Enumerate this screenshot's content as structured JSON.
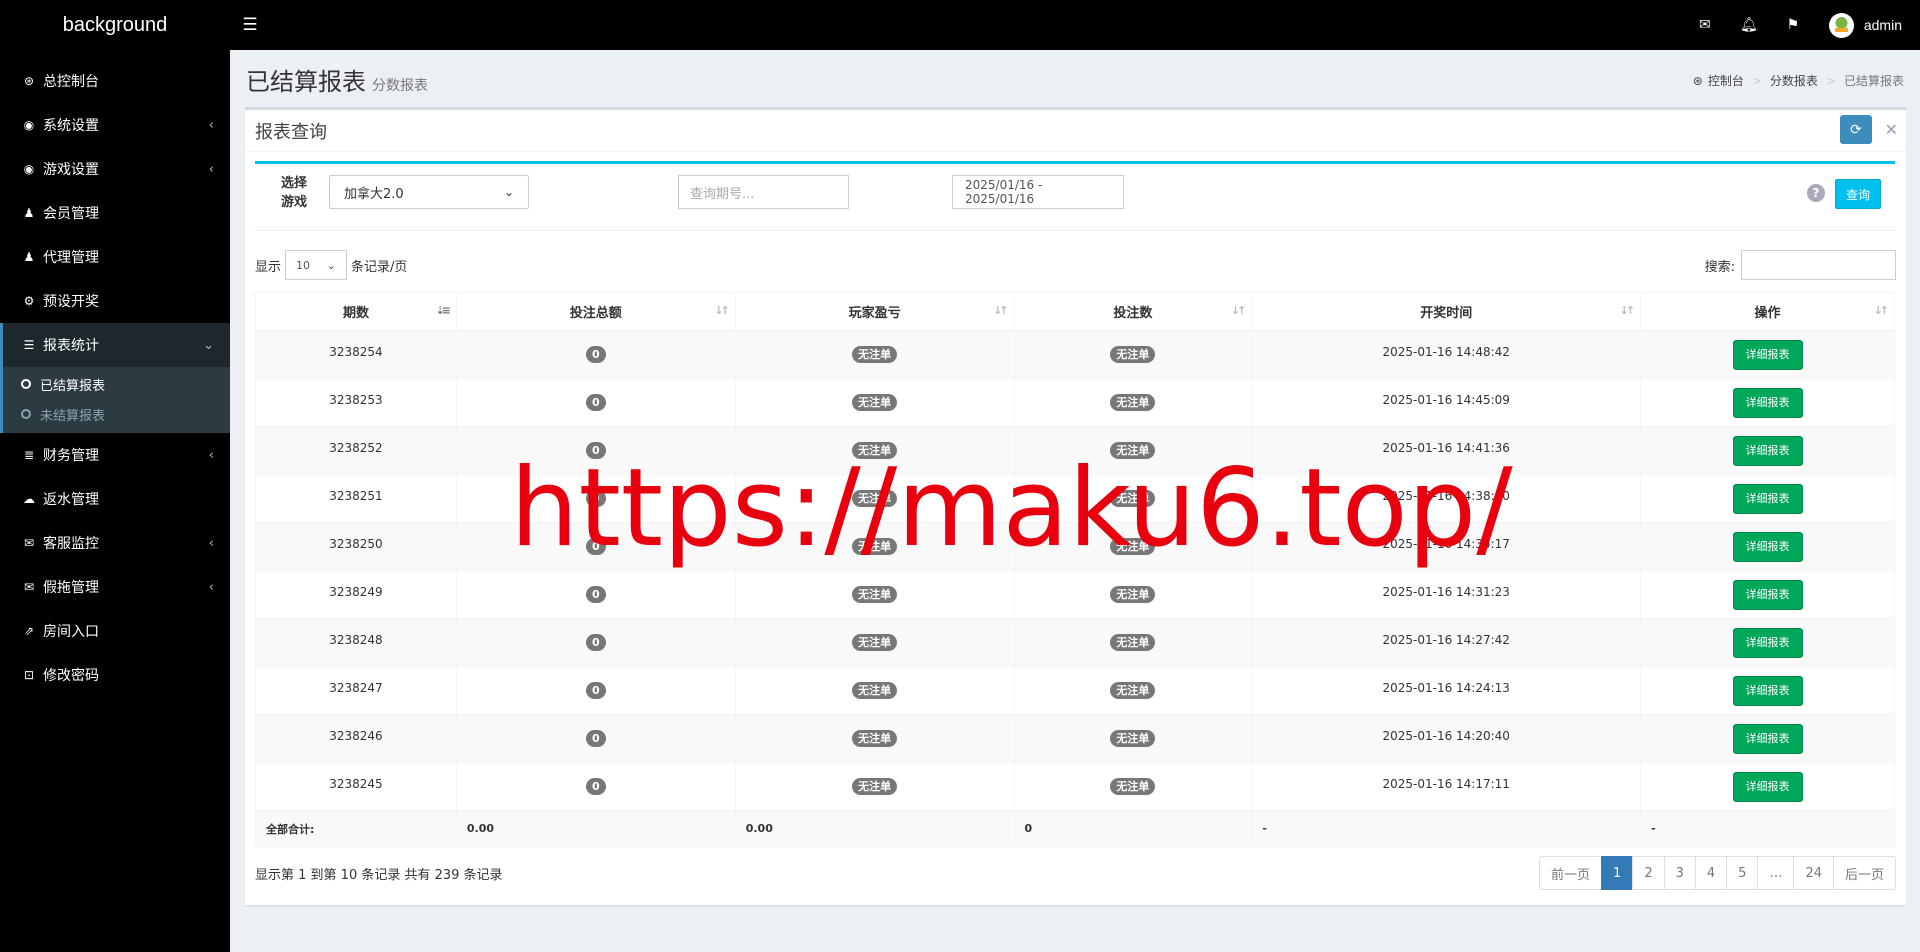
{
  "header": {
    "logo": "background",
    "user_name": "admin",
    "icons": [
      "menu-toggle-icon",
      "envelope-icon",
      "bell-icon",
      "flag-icon"
    ]
  },
  "sidebar": {
    "items": [
      {
        "label": "总控制台",
        "icon": "dashboard-icon",
        "glyph": "⊛",
        "chevron": false
      },
      {
        "label": "系统设置",
        "icon": "gamepad-icon",
        "glyph": "◉",
        "chevron": true
      },
      {
        "label": "游戏设置",
        "icon": "gamepad-icon",
        "glyph": "◉",
        "chevron": true
      },
      {
        "label": "会员管理",
        "icon": "users-icon",
        "glyph": "♟",
        "chevron": false
      },
      {
        "label": "代理管理",
        "icon": "users-icon",
        "glyph": "♟",
        "chevron": false
      },
      {
        "label": "预设开奖",
        "icon": "gears-icon",
        "glyph": "⚙",
        "chevron": false
      },
      {
        "label": "报表统计",
        "icon": "list-icon",
        "glyph": "☰",
        "chevron": true,
        "active": true,
        "children": [
          {
            "label": "已结算报表",
            "current": true
          },
          {
            "label": "未结算报表",
            "current": false
          }
        ]
      },
      {
        "label": "财务管理",
        "icon": "database-icon",
        "glyph": "≣",
        "chevron": true
      },
      {
        "label": "返水管理",
        "icon": "cloud-download-icon",
        "glyph": "☁",
        "chevron": false
      },
      {
        "label": "客服监控",
        "icon": "comments-icon",
        "glyph": "✉",
        "chevron": true
      },
      {
        "label": "假拖管理",
        "icon": "comment-icon",
        "glyph": "✉",
        "chevron": true
      },
      {
        "label": "房间入口",
        "icon": "external-link-icon",
        "glyph": "⇗",
        "chevron": false
      },
      {
        "label": "修改密码",
        "icon": "cart-icon",
        "glyph": "⊡",
        "chevron": false
      }
    ]
  },
  "page": {
    "title": "已结算报表",
    "subtitle": "分数报表",
    "breadcrumb": [
      "控制台",
      "分数报表",
      "已结算报表"
    ]
  },
  "box": {
    "title": "报表查询",
    "filter": {
      "label": "选择游戏",
      "game_value": "加拿大2.0",
      "period_placeholder": "查询期号...",
      "date_range": "2025/01/16 - 2025/01/16",
      "query_label": "查询",
      "help_glyph": "?"
    },
    "length": {
      "prefix": "显示",
      "value": "10",
      "suffix": "条记录/页"
    },
    "search_label": "搜索:"
  },
  "table": {
    "columns": [
      "期数",
      "投注总额",
      "玩家盈亏",
      "投注数",
      "开奖时间",
      "操作"
    ],
    "rows": [
      {
        "period": "3238254",
        "total": "0",
        "profit": "无注单",
        "count": "无注单",
        "time": "2025-01-16 14:48:42",
        "action": "详细报表"
      },
      {
        "period": "3238253",
        "total": "0",
        "profit": "无注单",
        "count": "无注单",
        "time": "2025-01-16 14:45:09",
        "action": "详细报表"
      },
      {
        "period": "3238252",
        "total": "0",
        "profit": "无注单",
        "count": "无注单",
        "time": "2025-01-16 14:41:36",
        "action": "详细报表"
      },
      {
        "period": "3238251",
        "total": "0",
        "profit": "无注单",
        "count": "无注单",
        "time": "2025-01-16 14:38:10",
        "action": "详细报表"
      },
      {
        "period": "3238250",
        "total": "0",
        "profit": "无注单",
        "count": "无注单",
        "time": "2025-01-16 14:35:17",
        "action": "详细报表"
      },
      {
        "period": "3238249",
        "total": "0",
        "profit": "无注单",
        "count": "无注单",
        "time": "2025-01-16 14:31:23",
        "action": "详细报表"
      },
      {
        "period": "3238248",
        "total": "0",
        "profit": "无注单",
        "count": "无注单",
        "time": "2025-01-16 14:27:42",
        "action": "详细报表"
      },
      {
        "period": "3238247",
        "total": "0",
        "profit": "无注单",
        "count": "无注单",
        "time": "2025-01-16 14:24:13",
        "action": "详细报表"
      },
      {
        "period": "3238246",
        "total": "0",
        "profit": "无注单",
        "count": "无注单",
        "time": "2025-01-16 14:20:40",
        "action": "详细报表"
      },
      {
        "period": "3238245",
        "total": "0",
        "profit": "无注单",
        "count": "无注单",
        "time": "2025-01-16 14:17:11",
        "action": "详细报表"
      }
    ],
    "totals": {
      "label": "全部合计:",
      "total": "0.00",
      "profit": "0.00",
      "count": "0",
      "time": "-",
      "action": "-"
    }
  },
  "footer": {
    "info": "显示第 1 到第 10 条记录 共有 239 条记录",
    "pager": [
      "前一页",
      "1",
      "2",
      "3",
      "4",
      "5",
      "…",
      "24",
      "后一页"
    ],
    "active_page": "1"
  },
  "watermark": "https://maku6.top/",
  "colors": {
    "accent": "#3c8dbc",
    "info": "#00c0ef",
    "success": "#00a65a",
    "watermark": "#e8000e"
  }
}
